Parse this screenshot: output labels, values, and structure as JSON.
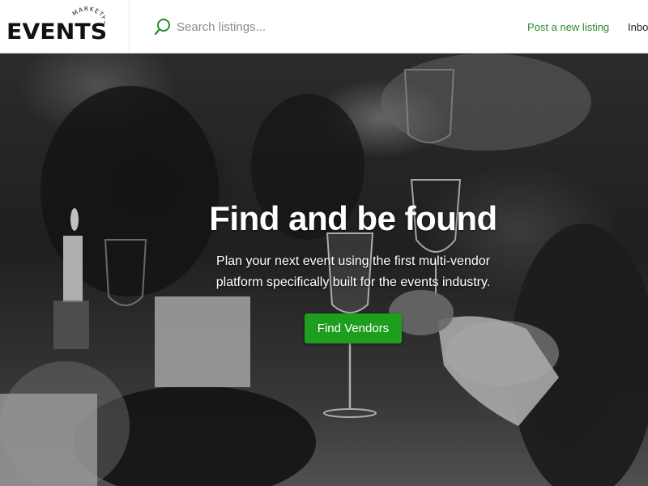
{
  "header": {
    "logo": {
      "wordmark": "EVENTS",
      "tagline": "MARKETPLACE"
    },
    "search": {
      "placeholder": "Search listings..."
    },
    "nav": {
      "post_listing": "Post a new listing",
      "inbox": "Inbo"
    }
  },
  "hero": {
    "title": "Find and be found",
    "subtitle": "Plan your next event using the first multi-vendor platform specifically built for the events industry.",
    "cta_label": "Find Vendors",
    "place_card_text": "",
    "background": "black-and-white photo of guests toasting with champagne glasses at a candlelit event dinner"
  },
  "colors": {
    "accent_green": "#1e9e1e",
    "link_green": "#2a8a2a",
    "header_bg": "#ffffff"
  },
  "icons": {
    "search": "search-icon"
  }
}
